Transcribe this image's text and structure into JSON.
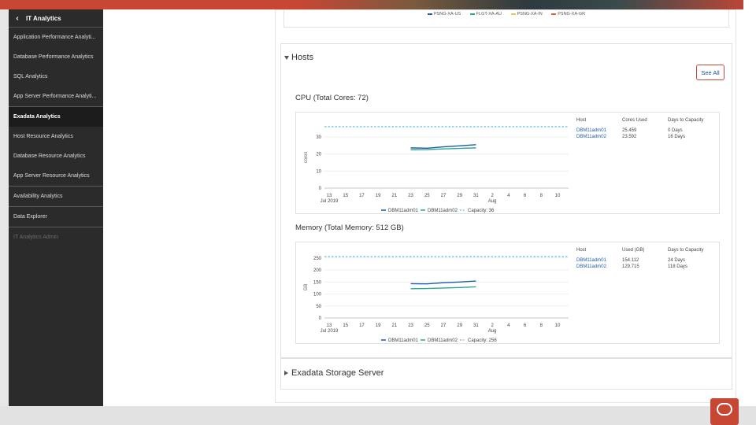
{
  "sidebar": {
    "title": "IT Analytics",
    "back_icon": "chevron-left-icon",
    "items": [
      {
        "label": "Application Performance Analyti..."
      },
      {
        "label": "Database Performance Analytics"
      },
      {
        "label": "SQL Analytics"
      },
      {
        "label": "App Server Performance Analyti..."
      },
      {
        "label": "Exadata Analytics"
      },
      {
        "label": "Host Resource Analytics"
      },
      {
        "label": "Database Resource Analytics"
      },
      {
        "label": "App Server Resource Analytics"
      },
      {
        "label": "Availability Analytics"
      },
      {
        "label": "Data Explorer"
      },
      {
        "label": "IT Analytics Admin"
      }
    ]
  },
  "top_legend": [
    {
      "name": "PSNG-XA-US",
      "color": "#1f5aa6"
    },
    {
      "name": "FLGT-XA-AU",
      "color": "#2ca58d"
    },
    {
      "name": "PSNG-XA-IN",
      "color": "#e6c84a"
    },
    {
      "name": "PSNG-XA-GR",
      "color": "#e0593a"
    }
  ],
  "hosts": {
    "title": "Hosts",
    "see_all": "See All",
    "table_headers": {
      "host": "Host",
      "days": "Days to Capacity"
    }
  },
  "cpu": {
    "title": "CPU (Total Cores: 72)",
    "used_header": "Cores Used",
    "rows": [
      {
        "host": "DBM11adm01",
        "used": "25.459",
        "days": "0 Days"
      },
      {
        "host": "DBM11adm02",
        "used": "23.592",
        "days": "16 Days"
      }
    ]
  },
  "memory": {
    "title": "Memory (Total Memory: 512 GB)",
    "used_header": "Used (GB)",
    "rows": [
      {
        "host": "DBM11adm01",
        "used": "154.112",
        "days": "24 Days"
      },
      {
        "host": "DBM11adm02",
        "used": "129.715",
        "days": "118 Days"
      }
    ]
  },
  "storage": {
    "title": "Exadata Storage Server"
  },
  "chart_data": [
    {
      "type": "line",
      "ylabel": "cores",
      "ylim": [
        0,
        36
      ],
      "y_ticks": [
        0,
        10,
        20,
        30
      ],
      "x_ticks": [
        "13",
        "15",
        "17",
        "19",
        "21",
        "23",
        "25",
        "27",
        "29",
        "31",
        "2",
        "4",
        "6",
        "8",
        "10"
      ],
      "x_sub": {
        "13": "Jul 2019",
        "2": "Aug"
      },
      "x": [
        "23",
        "25",
        "27",
        "29",
        "31"
      ],
      "series": [
        {
          "name": "DBM11adm01",
          "color": "#1f5aa6",
          "values": [
            23.6,
            23.4,
            24.2,
            24.8,
            25.459
          ]
        },
        {
          "name": "DBM11adm02",
          "color": "#2ca58d",
          "values": [
            22.5,
            22.6,
            23.0,
            23.3,
            23.592
          ]
        }
      ],
      "capacity": {
        "name": "Capacity: 36",
        "value": 36,
        "color": "#7fc5e8"
      },
      "grid": true,
      "legend": "bottom"
    },
    {
      "type": "line",
      "ylabel": "GB",
      "ylim": [
        0,
        256
      ],
      "y_ticks": [
        0,
        50,
        100,
        150,
        200,
        250
      ],
      "x_ticks": [
        "13",
        "15",
        "17",
        "19",
        "21",
        "23",
        "25",
        "27",
        "29",
        "31",
        "2",
        "4",
        "6",
        "8",
        "10"
      ],
      "x_sub": {
        "13": "Jul 2019",
        "2": "Aug"
      },
      "x": [
        "23",
        "25",
        "27",
        "29",
        "31"
      ],
      "series": [
        {
          "name": "DBM11adm01",
          "color": "#1f5aa6",
          "values": [
            143,
            142,
            147,
            150,
            154.112
          ]
        },
        {
          "name": "DBM11adm02",
          "color": "#2ca58d",
          "values": [
            122,
            123,
            125,
            127,
            129.715
          ]
        }
      ],
      "capacity": {
        "name": "Capacity: 256",
        "value": 256,
        "color": "#7fc5e8"
      },
      "grid": true,
      "legend": "bottom"
    }
  ]
}
